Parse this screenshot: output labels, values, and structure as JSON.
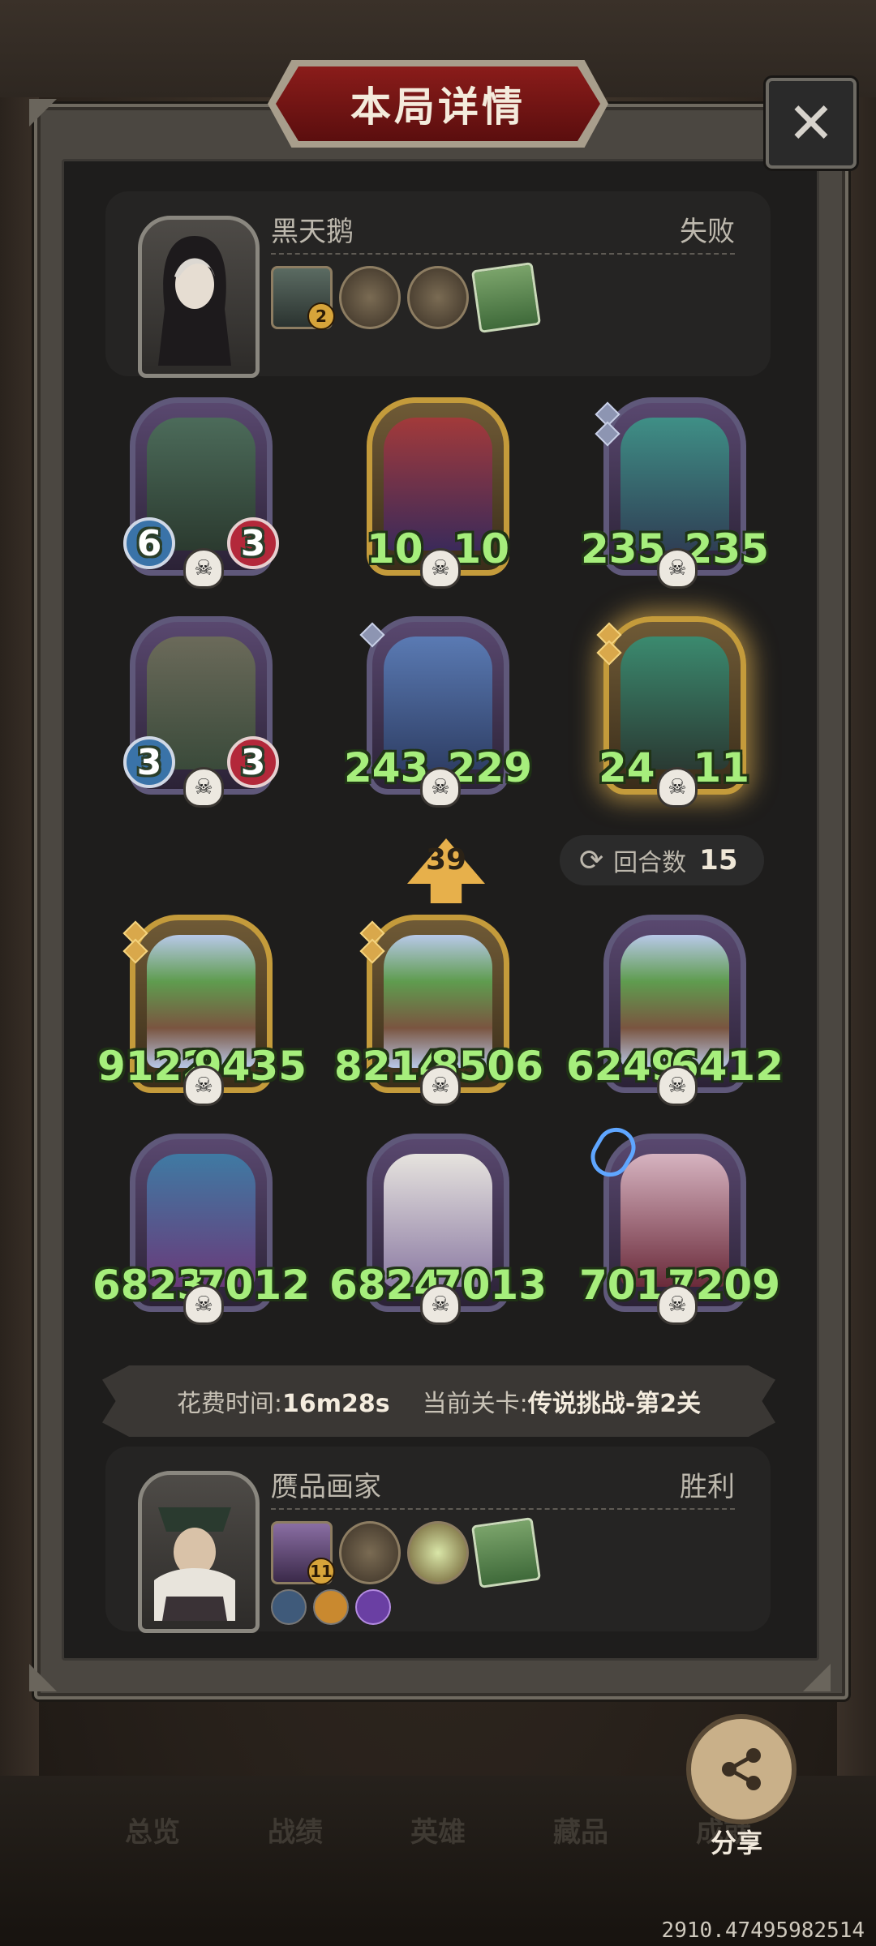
{
  "title": "本局详情",
  "close_icon": "close-icon",
  "player_top": {
    "name": "黑天鹅",
    "result": "失败",
    "items": [
      {
        "icon": "swirl-artifact-icon",
        "badge": "2"
      },
      {
        "icon": "mirror-artifact-icon"
      },
      {
        "icon": "gate-medallion-icon"
      },
      {
        "icon": "green-book-icon"
      }
    ]
  },
  "opponent_units": [
    {
      "atk": "6",
      "hp": "3"
    },
    {
      "atk": "10",
      "hp": "10"
    },
    {
      "atk": "235",
      "hp": "235"
    },
    {
      "atk": "3",
      "hp": "3"
    },
    {
      "atk": "243",
      "hp": "229"
    },
    {
      "atk": "24",
      "hp": "11"
    }
  ],
  "tier": "39",
  "rounds": {
    "label": "回合数",
    "value": "15"
  },
  "player_units": [
    {
      "atk": "9122",
      "hp": "9435"
    },
    {
      "atk": "8214",
      "hp": "8506"
    },
    {
      "atk": "6249",
      "hp": "6412"
    },
    {
      "atk": "6823",
      "hp": "7012"
    },
    {
      "atk": "6824",
      "hp": "7013"
    },
    {
      "atk": "7011",
      "hp": "7209"
    }
  ],
  "info": {
    "time_label": "花费时间:",
    "time_value": "16m28s",
    "stage_label": "当前关卡:",
    "stage_value": "传说挑战-第2关"
  },
  "player_bottom": {
    "name": "赝品画家",
    "result": "胜利",
    "items": [
      {
        "icon": "painting-artifact-icon",
        "badge": "11"
      },
      {
        "icon": "mirror-artifact-icon"
      },
      {
        "icon": "crystal-medallion-icon"
      },
      {
        "icon": "green-book-icon"
      }
    ]
  },
  "share_label": "分享",
  "nav": [
    "总览",
    "战绩",
    "英雄",
    "藏品",
    "成就"
  ],
  "coord_readout": "2910.47495982514"
}
